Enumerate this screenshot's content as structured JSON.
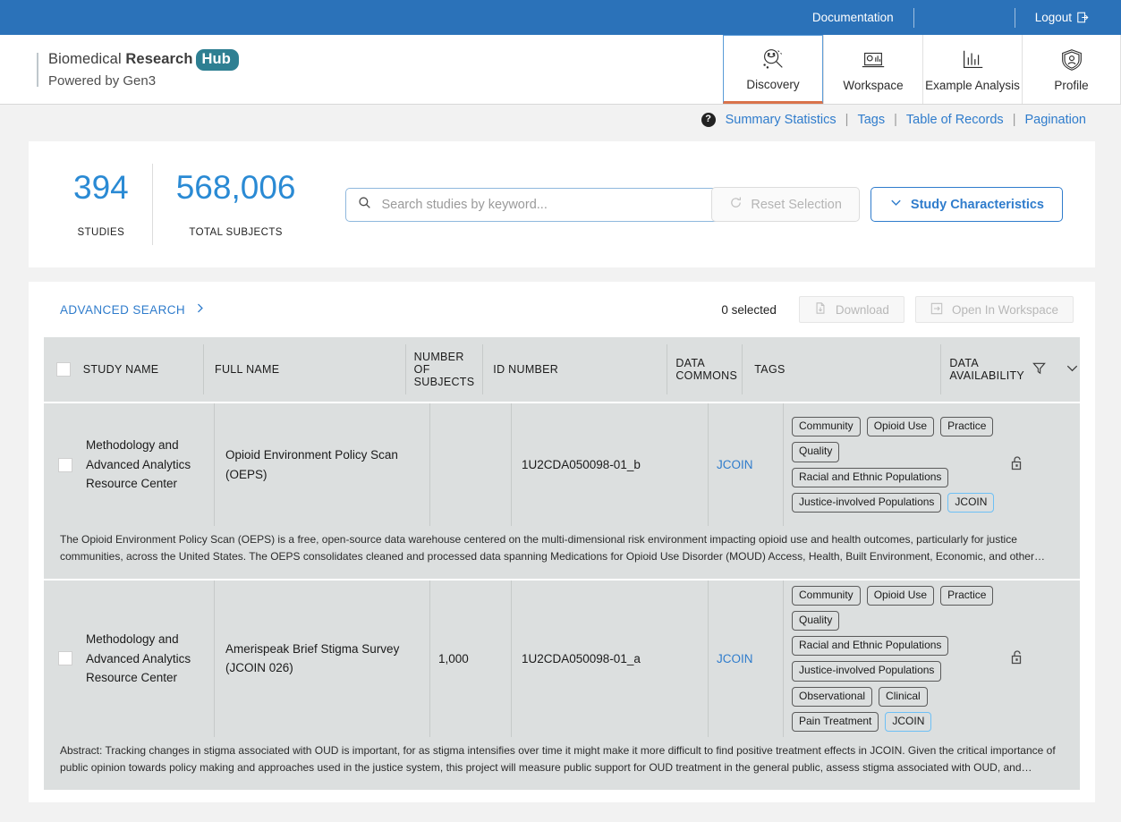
{
  "topbar": {
    "documentation": "Documentation",
    "logout": "Logout",
    "logout_icon": "logout-arrow-icon"
  },
  "header": {
    "logo": {
      "line1_plain": "Biomedical",
      "line1_bold": "Research",
      "line1_badge": "Hub",
      "line2": "Powered by Gen3"
    },
    "nav": [
      {
        "label": "Discovery",
        "icon": "magnifier-data-icon",
        "active": true
      },
      {
        "label": "Workspace",
        "icon": "laptop-workspace-icon",
        "active": false
      },
      {
        "label": "Example Analysis",
        "icon": "bar-chart-icon",
        "active": false
      },
      {
        "label": "Profile",
        "icon": "shield-user-icon",
        "active": false
      }
    ]
  },
  "subnav": {
    "help_icon": "question-mark-icon",
    "links": [
      "Summary Statistics",
      "Tags",
      "Table of Records",
      "Pagination"
    ],
    "separator": "|"
  },
  "stats": {
    "studies_value": "394",
    "studies_label": "STUDIES",
    "subjects_value": "568,006",
    "subjects_label": "TOTAL SUBJECTS",
    "search_placeholder": "Search studies by keyword...",
    "search_value": "",
    "search_icon": "search-icon",
    "reset_button": "Reset Selection",
    "reset_icon": "refresh-circle-icon",
    "characteristics_button": "Study Characteristics",
    "characteristics_icon": "chevron-down-icon"
  },
  "results": {
    "advanced_search": "ADVANCED SEARCH",
    "advanced_search_icon": "chevron-right-icon",
    "selected_count": "0 selected",
    "download_button": "Download",
    "download_icon": "file-download-icon",
    "workspace_button": "Open In Workspace",
    "workspace_icon": "open-in-workspace-icon",
    "filter_icon": "funnel-filter-icon",
    "collapse_icon": "chevron-down-icon"
  },
  "table": {
    "columns": [
      "STUDY NAME",
      "FULL NAME",
      "NUMBER OF SUBJECTS",
      "ID NUMBER",
      "DATA COMMONS",
      "TAGS",
      "DATA AVAILABILITY"
    ],
    "rows": [
      {
        "study_name": "Methodology and Advanced Analytics Resource Center",
        "full_name": "Opioid Environment Policy Scan (OEPS)",
        "subjects": "",
        "id_number": "1U2CDA050098-01_b",
        "data_commons": "JCOIN",
        "tags": [
          {
            "label": "Community",
            "style": "default"
          },
          {
            "label": "Opioid Use",
            "style": "default"
          },
          {
            "label": "Practice",
            "style": "default"
          },
          {
            "label": "Quality",
            "style": "default"
          },
          {
            "label": "Racial and Ethnic Populations",
            "style": "default"
          },
          {
            "label": "Justice-involved Populations",
            "style": "default"
          },
          {
            "label": "JCOIN",
            "style": "blue"
          }
        ],
        "availability_icon": "open-padlock-icon",
        "description": "The Opioid Environment Policy Scan (OEPS) is a free, open-source data warehouse centered on the multi-dimensional risk environment impacting opioid use and health outcomes, particularly for justice communities, across the United States. The OEPS consolidates cleaned and processed data spanning Medications for Opioid Use Disorder (MOUD) Access, Health, Built Environment, Economic, and other…"
      },
      {
        "study_name": "Methodology and Advanced Analytics Resource Center",
        "full_name": "Amerispeak Brief Stigma Survey (JCOIN 026)",
        "subjects": "1,000",
        "id_number": "1U2CDA050098-01_a",
        "data_commons": "JCOIN",
        "tags": [
          {
            "label": "Community",
            "style": "default"
          },
          {
            "label": "Opioid Use",
            "style": "default"
          },
          {
            "label": "Practice",
            "style": "default"
          },
          {
            "label": "Quality",
            "style": "default"
          },
          {
            "label": "Racial and Ethnic Populations",
            "style": "default"
          },
          {
            "label": "Justice-involved Populations",
            "style": "default"
          },
          {
            "label": "Observational",
            "style": "default"
          },
          {
            "label": "Clinical",
            "style": "default"
          },
          {
            "label": "Pain Treatment",
            "style": "default"
          },
          {
            "label": "JCOIN",
            "style": "blue"
          }
        ],
        "availability_icon": "open-padlock-icon",
        "description": "Abstract: Tracking changes in stigma associated with OUD is important, for as stigma intensifies over time it might make it more difficult to find positive treatment effects in JCOIN. Given the critical importance of public opinion towards policy making and approaches used in the justice system, this project will measure public support for OUD treatment in the general public, assess stigma associated with OUD, and…"
      }
    ]
  },
  "colors": {
    "topbar_blue": "#2b72b9",
    "link_blue": "#2f7ccc",
    "stat_blue": "#2a8ad4",
    "hub_teal": "#2e7f92",
    "active_tab_underline": "#d9734b",
    "table_bg": "#dcdfdf"
  }
}
